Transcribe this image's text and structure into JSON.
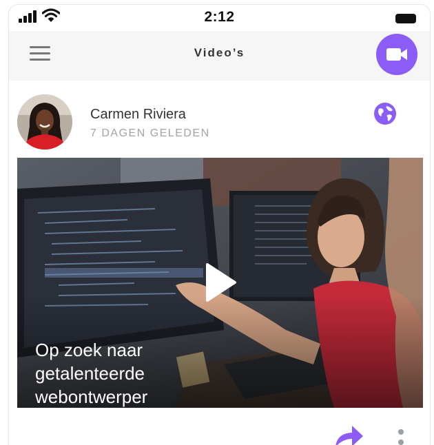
{
  "status_bar": {
    "time": "2:12"
  },
  "header": {
    "title": "Video’s",
    "menu_icon": "hamburger-menu-icon",
    "action_icon": "video-camera-icon"
  },
  "post": {
    "author": "Carmen Riviera",
    "time_ago": "7 DAGEN GELEDEN",
    "visibility_icon": "globe-icon",
    "video": {
      "title_lines": [
        "Op zoek naar",
        "getalenteerde",
        "webontwerper"
      ],
      "play_icon": "play-icon"
    },
    "actions": {
      "share_icon": "share-icon",
      "more_icon": "more-vertical-icon"
    }
  },
  "colors": {
    "accent": "#8b5cf6",
    "header_bg": "#f6f6f6",
    "muted_text": "#a3a3a3",
    "text": "#333333"
  }
}
